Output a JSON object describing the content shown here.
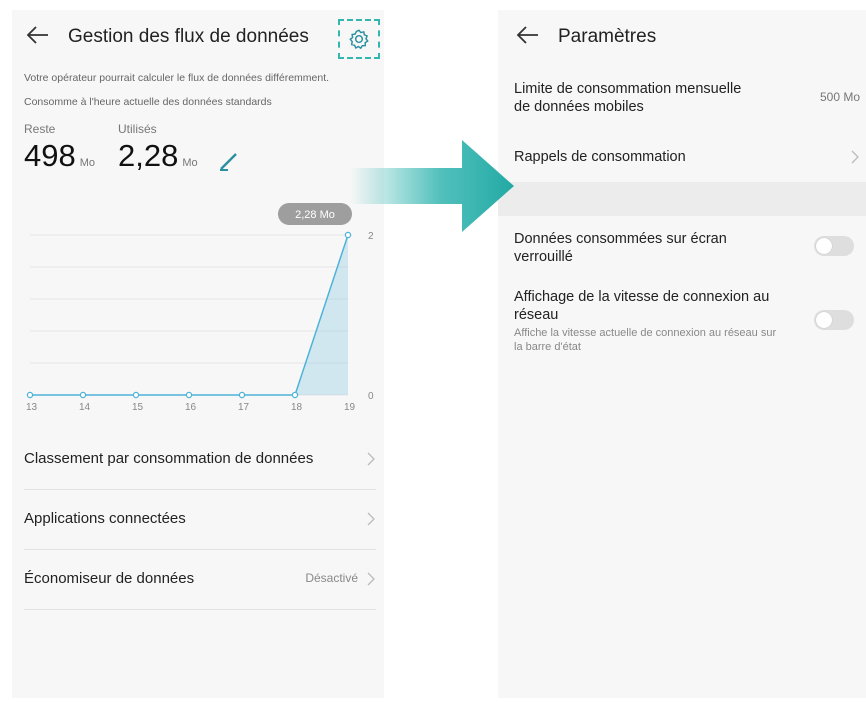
{
  "left_screen": {
    "title": "Gestion des flux de données",
    "note_operator": "Votre opérateur pourrait calculer le flux de données différemment.",
    "note_current": "Consomme à l'heure actuelle des données standards",
    "remaining": {
      "label": "Reste",
      "value": "498",
      "unit": "Mo"
    },
    "used": {
      "label": "Utilisés",
      "value": "2,28",
      "unit": "Mo"
    },
    "tooltip": "2,28 Mo",
    "list": [
      {
        "label": "Classement par consommation de données",
        "value": ""
      },
      {
        "label": "Applications connectées",
        "value": ""
      },
      {
        "label": "Économiseur de données",
        "value": "Désactivé"
      }
    ]
  },
  "chart_data": {
    "type": "area",
    "x": [
      "13",
      "14",
      "15",
      "16",
      "17",
      "18",
      "19"
    ],
    "values": [
      0,
      0,
      0,
      0,
      0,
      0,
      2
    ],
    "y_ticks": [
      "0",
      "2"
    ],
    "ylim": [
      0,
      2
    ],
    "grid": true,
    "color": "#4fb3d9"
  },
  "right_screen": {
    "title": "Paramètres",
    "monthly_limit_label": "Limite de consommation mensuelle de données mobiles",
    "monthly_limit_value": "500 Mo",
    "reminders_label": "Rappels de consommation",
    "lock_screen_label": "Données consommées sur écran verrouillé",
    "network_speed_label": "Affichage de la vitesse de connexion au réseau",
    "network_speed_sub": "Affiche la vitesse actuelle de connexion au réseau sur la barre d'état",
    "lock_screen_enabled": false,
    "network_speed_enabled": false
  },
  "icons": {
    "back": "back-arrow-icon",
    "settings": "gear-icon",
    "edit": "pencil-icon",
    "chevron": "chevron-right-icon",
    "flow": "teal-arrow-icon"
  },
  "colors": {
    "accent": "#33b5b0",
    "chart_line": "#4fb3d9",
    "tooltip_bg": "#9e9e9e",
    "toggle_off": "#dedede"
  }
}
